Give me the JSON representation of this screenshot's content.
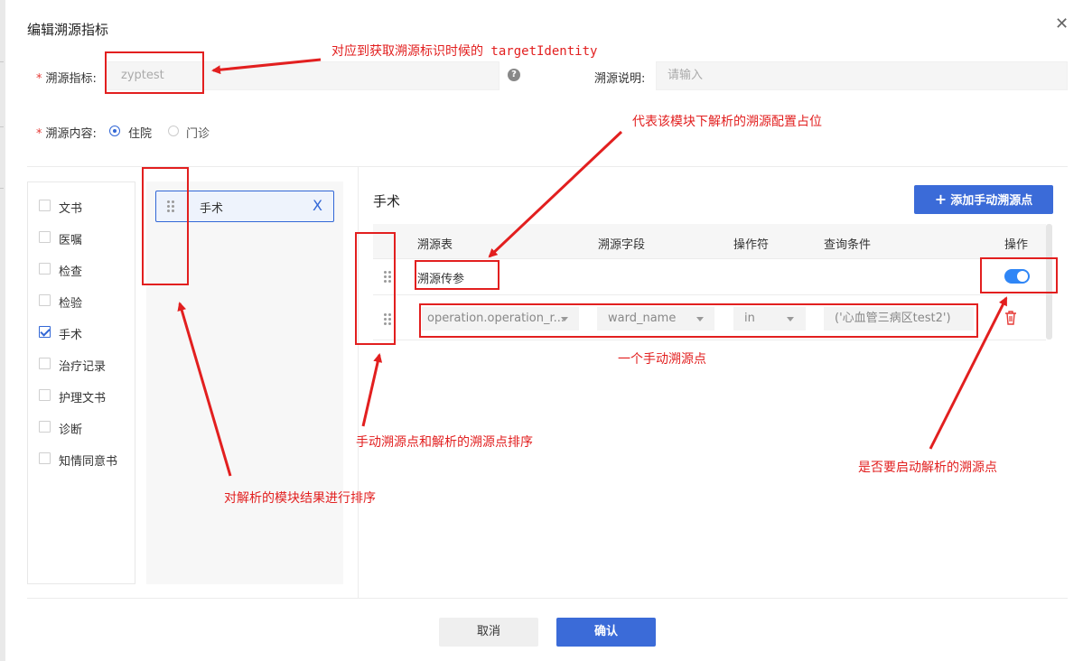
{
  "dialog": {
    "title": "编辑溯源指标",
    "close_symbol": "✕",
    "cancel_label": "取消",
    "confirm_label": "确认"
  },
  "form": {
    "required_mark": "*",
    "indicator_label": "溯源指标:",
    "indicator_value": "zyptest",
    "help_symbol": "?",
    "desc_label": "溯源说明:",
    "desc_placeholder": "请输入",
    "content_label": "溯源内容:",
    "content_options": [
      "住院",
      "门诊"
    ],
    "content_selected": "住院"
  },
  "modules": {
    "items": [
      {
        "label": "文书",
        "checked": false
      },
      {
        "label": "医嘱",
        "checked": false
      },
      {
        "label": "检查",
        "checked": false
      },
      {
        "label": "检验",
        "checked": false
      },
      {
        "label": "手术",
        "checked": true
      },
      {
        "label": "治疗记录",
        "checked": false
      },
      {
        "label": "护理文书",
        "checked": false
      },
      {
        "label": "诊断",
        "checked": false
      },
      {
        "label": "知情同意书",
        "checked": false
      }
    ]
  },
  "selected_module": {
    "label": "手术",
    "remove_symbol": "X"
  },
  "detail": {
    "title": "手术",
    "add_button_label": "添加手动溯源点",
    "add_icon": "+",
    "columns": [
      "溯源表",
      "溯源字段",
      "操作符",
      "查询条件",
      "操作"
    ],
    "parsed_row": {
      "table": "溯源传参",
      "enabled": true
    },
    "manual_row": {
      "table": "operation.operation_r...",
      "field": "ward_name",
      "operator": "in",
      "condition": "('心血管三病区test2')",
      "delete_icon": "trash-icon"
    }
  },
  "annotations": {
    "target_identity": "对应到获取溯源标识时候的 targetIdentity",
    "module_placeholder": "代表该模块下解析的溯源配置占位",
    "manual_point": "一个手动溯源点",
    "sort_points": "手动溯源点和解析的溯源点排序",
    "enable_parsed": "是否要启动解析的溯源点",
    "sort_modules": "对解析的模块结果进行排序"
  },
  "colors": {
    "primary": "#3b6bd8",
    "annotation_red": "#e21f1f",
    "toggle_on": "#2f86f6"
  }
}
